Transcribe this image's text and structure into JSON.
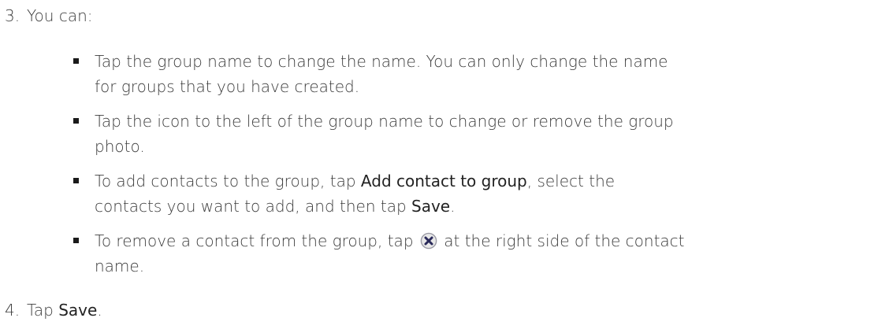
{
  "steps": [
    {
      "number": "3.",
      "text": "You can:"
    },
    {
      "number": "4.",
      "text_before": "Tap ",
      "ui_term": "Save",
      "text_after": "."
    }
  ],
  "bullets": [
    {
      "line1": "Tap the group name to change the name. You can only change the name",
      "line2": "for groups that you have created."
    },
    {
      "line1": "Tap the icon to the left of the group name to change or remove the group",
      "line2": "photo."
    },
    {
      "line1_a": "To add contacts to the group, tap ",
      "line1_ui": "Add contact to group",
      "line1_b": ", select the",
      "line2_a": "contacts you want to add, and then tap ",
      "line2_ui": "Save",
      "line2_b": "."
    },
    {
      "line1_a": "To remove a contact from the group, tap ",
      "line1_icon": "remove-x-circle-icon",
      "line1_b": " at the right side of the contact",
      "line2": "name."
    }
  ],
  "colors": {
    "text": "#3c3c3c",
    "bullet": "#1a1a1a",
    "icon_fill": "#e8e8e8",
    "icon_x": "#2a2a5a"
  }
}
